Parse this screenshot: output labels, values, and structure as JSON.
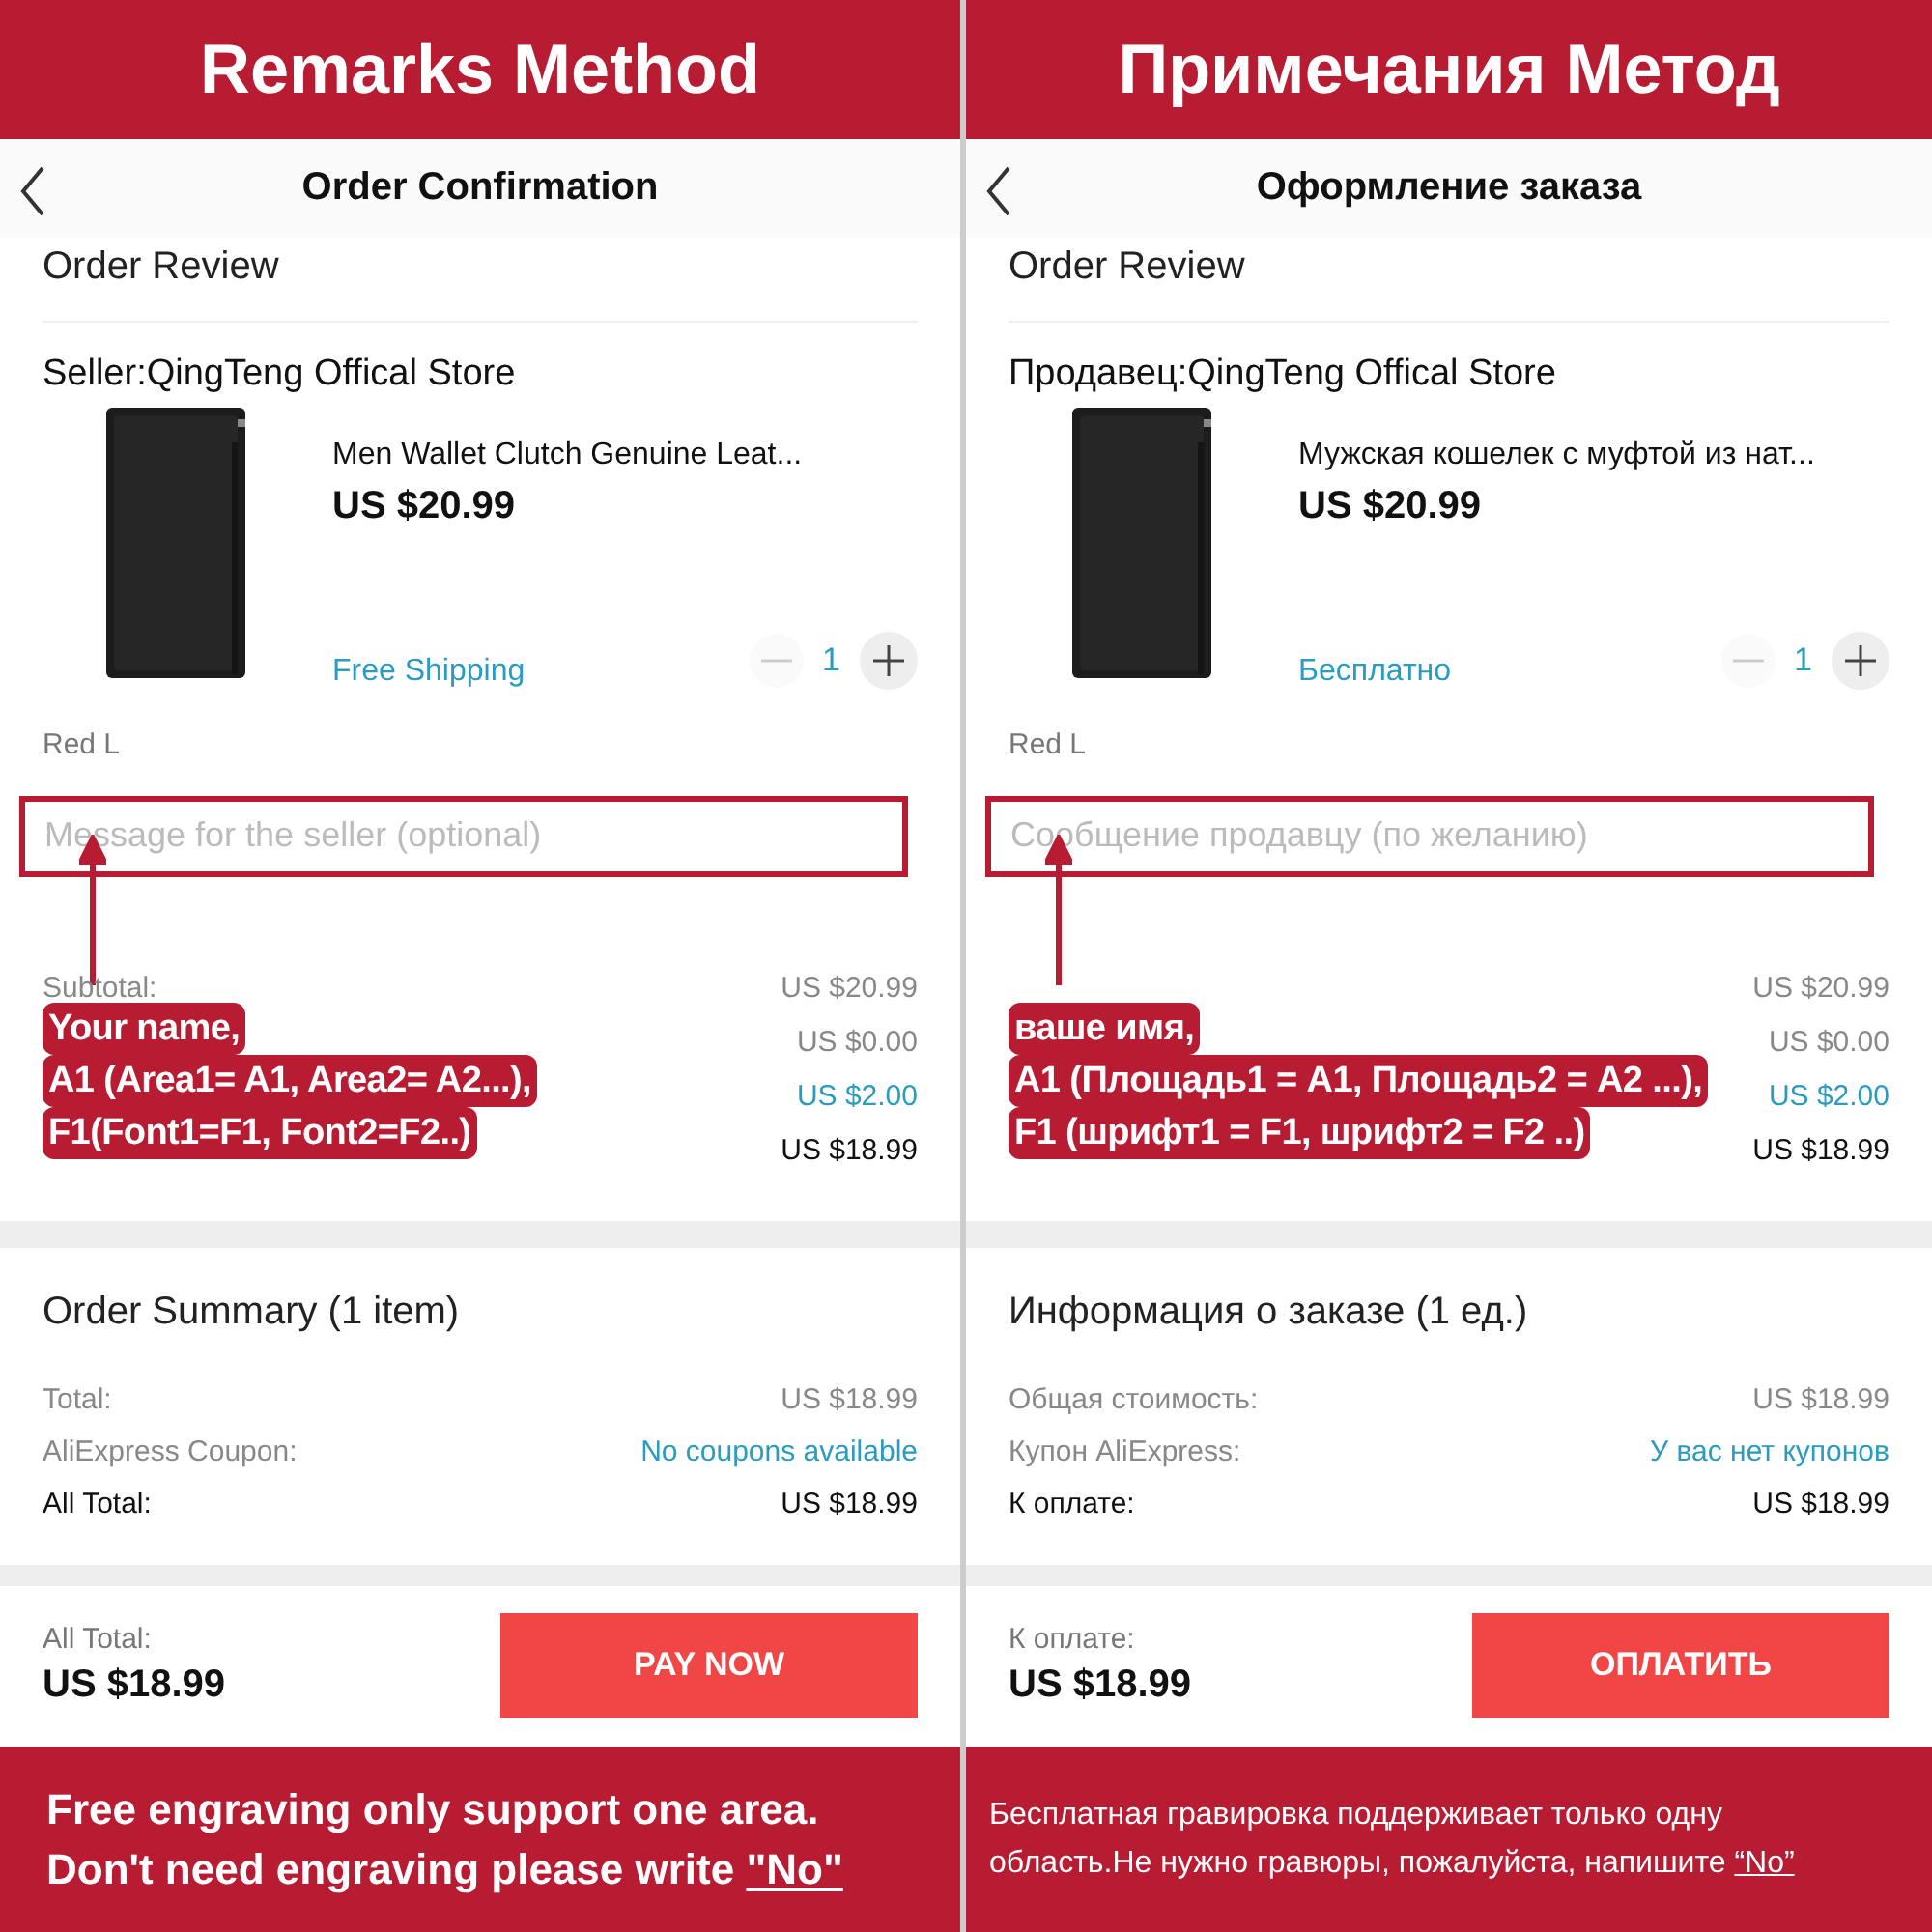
{
  "panels": [
    {
      "header": "Remarks Method",
      "nav_title": "Order Confirmation",
      "section_title": "Order Review",
      "seller": "Seller:QingTeng Offical Store",
      "product": {
        "title": "Men Wallet Clutch Genuine Leat...",
        "price": "US $20.99",
        "shipping": "Free Shipping",
        "quantity": "1"
      },
      "variant": "Red L",
      "message_placeholder": "Message for the seller (optional)",
      "note": [
        "Your name,",
        "A1  (Area1= A1, Area2= A2...),",
        "F1(Font1=F1, Font2=F2..)"
      ],
      "summary_rows": [
        {
          "label": "Subtotal:",
          "value": "US $20.99",
          "kind": "plain"
        },
        {
          "value": "US $0.00",
          "kind": "plain"
        },
        {
          "value": "US $2.00",
          "kind": "coupon"
        },
        {
          "value": "US $18.99",
          "kind": "total"
        }
      ],
      "order_summary_title": "Order Summary (1 item)",
      "totals": [
        {
          "label": "Total:",
          "value": "US $18.99",
          "kind": "plain"
        },
        {
          "label": "AliExpress Coupon:",
          "value": "No coupons available",
          "kind": "coupon"
        },
        {
          "label": "All Total:",
          "value": "US $18.99",
          "kind": "total"
        }
      ],
      "bottom": {
        "label": "All Total:",
        "amount": "US $18.99",
        "button": "PAY NOW"
      },
      "footer": {
        "kind": "large",
        "lines": [
          {
            "text": "Free engraving only support one area."
          },
          {
            "text": "Don't need engraving please write ",
            "underlined": "\"No\""
          }
        ]
      }
    },
    {
      "header": "Примечания Метод",
      "nav_title": "Оформление заказа",
      "section_title": "Order Review",
      "seller": "Продавец:QingTeng Offical Store",
      "product": {
        "title": "Мужская кошелек с муфтой из нат...",
        "price": "US $20.99",
        "shipping": "Бесплатно",
        "quantity": "1"
      },
      "variant": "Red L",
      "message_placeholder": "Сообщение продавцу (по желанию)",
      "note": [
        "ваше имя,",
        "A1 (Площадь1 = A1, Площадь2 = A2 ...),",
        "F1 (шрифт1 = F1, шрифт2 = F2 ..)"
      ],
      "summary_rows": [
        {
          "value": "US $20.99",
          "kind": "plain"
        },
        {
          "value": "US $0.00",
          "kind": "plain"
        },
        {
          "value": "US $2.00",
          "kind": "coupon"
        },
        {
          "value": "US $18.99",
          "kind": "total"
        }
      ],
      "order_summary_title": "Информация о заказе (1 ед.)",
      "totals": [
        {
          "label": "Общая стоимость:",
          "value": "US $18.99",
          "kind": "plain"
        },
        {
          "label": "Купон AliExpress:",
          "value": "У вас нет купонов",
          "kind": "coupon"
        },
        {
          "label": "К оплате:",
          "value": "US $18.99",
          "kind": "total"
        }
      ],
      "bottom": {
        "label": "К оплате:",
        "amount": "US $18.99",
        "button": "ОПЛАТИТЬ"
      },
      "footer": {
        "kind": "small",
        "lines": [
          {
            "text": "Бесплатная гравировка поддерживает только одну"
          },
          {
            "text": "область.Не нужно гравюры, пожалуйста, напишите ",
            "underlined": "“No”"
          }
        ]
      }
    }
  ]
}
